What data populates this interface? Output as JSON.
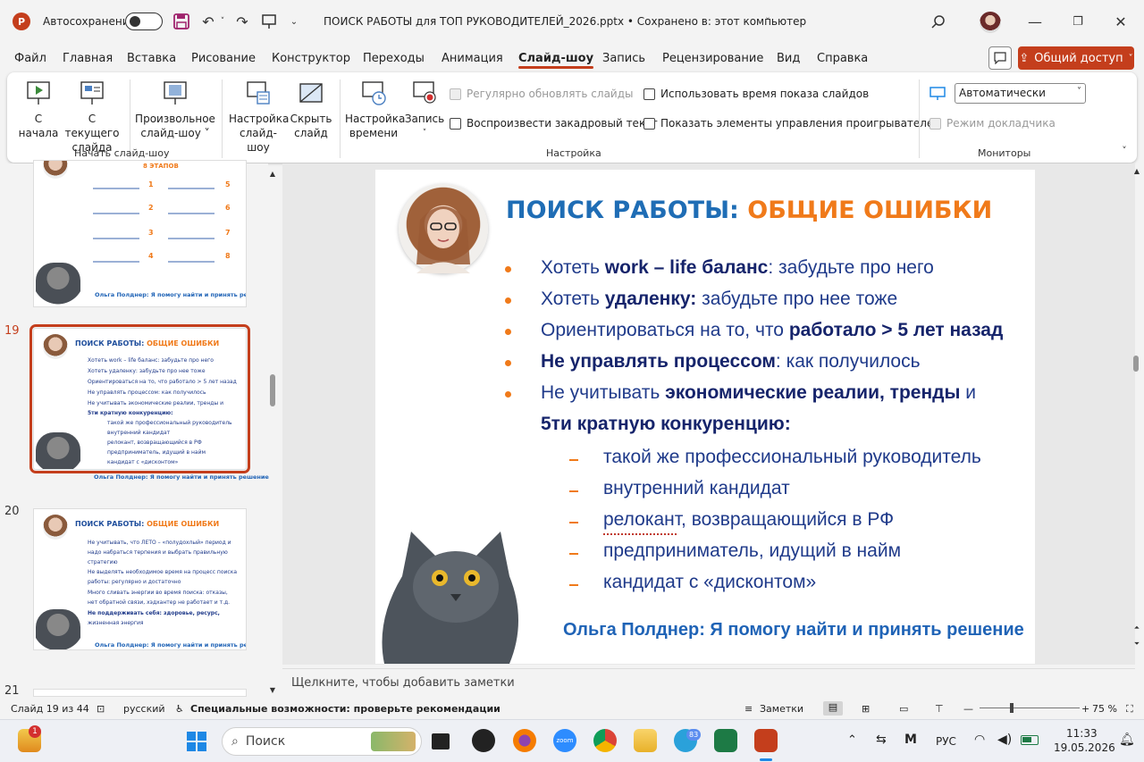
{
  "titlebar": {
    "autosave_label": "Автосохранение",
    "doc_title": "ПОИСК РАБОТЫ для ТОП РУКОВОДИТЕЛЕЙ_2026.pptx • Сохранено в: этот компьютер",
    "app_icon": "P"
  },
  "tabs": [
    "Файл",
    "Главная",
    "Вставка",
    "Рисование",
    "Конструктор",
    "Переходы",
    "Анимация",
    "Слайд-шоу",
    "Запись",
    "Рецензирование",
    "Вид",
    "Справка"
  ],
  "active_tab": "Слайд-шоу",
  "share_label": "Общий доступ",
  "ribbon": {
    "from_start": [
      "С",
      "начала"
    ],
    "from_current": [
      "С текущего",
      "слайда"
    ],
    "custom": [
      "Произвольное",
      "слайд-шоу ˅"
    ],
    "setup": [
      "Настройка",
      "слайд-шоу"
    ],
    "hide": [
      "Скрыть",
      "слайд"
    ],
    "timing": [
      "Настройка",
      "времени"
    ],
    "record": [
      "Запись",
      "˅"
    ],
    "group_start": "Начать слайд-шоу",
    "group_setup": "Настройка",
    "group_monitors": "Мониторы",
    "chk_refresh": "Регулярно обновлять слайды",
    "chk_narration": "Воспроизвести закадровый текст",
    "chk_timings": "Использовать время показа слайдов",
    "chk_controls": "Показать элементы управления проигрывателем",
    "chk_presenter": "Режим докладчика",
    "monitor_value": "Автоматически"
  },
  "thumbs": {
    "prev_title": "8 ЭТАПОВ",
    "prev_numbers": [
      "1",
      "5",
      "2",
      "6",
      "3",
      "7",
      "4",
      "8"
    ],
    "footer": "Ольга Полднер: Я помогу найти и принять решение",
    "n19": "19",
    "n20": "20",
    "n21": "21",
    "t19_title_a": "ПОИСК РАБОТЫ: ",
    "t19_title_b": "ОБЩИЕ ОШИБКИ",
    "t19_lines": [
      "Хотеть work – life баланс: забудьте про него",
      "Хотеть удаленку: забудьте про нее тоже",
      "Ориентироваться на то, что работало > 5 лет назад",
      "Не управлять процессом: как получилось",
      "Не учитывать экономические реалии, тренды и",
      "5ти кратную конкуренцию:",
      "такой же профессиональный руководитель",
      "внутренний кандидат",
      "релокант, возвращающийся в РФ",
      "предприниматель, идущий в найм",
      "кандидат с «дисконтом»"
    ],
    "t20_lines": [
      "Не учитывать, что ЛЕТО – «полудохлый» период и",
      "надо набраться терпения и выбрать правильную",
      "стратегию",
      "Не выделять необходимое время на процесс поиска",
      "работы: регулярно и достаточно",
      "Много сливать энергии во время поиска: отказы,",
      "нет обратной связи, хэдхантер не работает и т.д.",
      "Не поддерживать себя: здоровье, ресурс,",
      "жизненная энергия"
    ]
  },
  "slide": {
    "title_a": "ПОИСК РАБОТЫ: ",
    "title_b": "ОБЩИЕ ОШИБКИ",
    "b1_a": "Хотеть ",
    "b1_b": "work – life баланс",
    "b1_c": ": забудьте про него",
    "b2_a": "Хотеть ",
    "b2_b": "удаленку:",
    "b2_c": " забудьте про нее тоже",
    "b3_a": "Ориентироваться на то, что ",
    "b3_b": "работало > 5 лет назад",
    "b4_b": "Не управлять процессом",
    "b4_c": ": как получилось",
    "b5_a": "Не учитывать ",
    "b5_b": "экономические реалии, тренды",
    "b5_c": " и",
    "b6_b": "5ти кратную конкуренцию:",
    "sub": [
      "такой же профессиональный руководитель",
      "внутренний кандидат",
      "релокант, возвращающийся в РФ",
      "предприниматель, идущий в найм",
      "кандидат с «дисконтом»"
    ],
    "footer": "Ольга Полднер: Я помогу найти и принять решение"
  },
  "notes_placeholder": "Щелкните, чтобы добавить заметки",
  "status": {
    "slide": "Слайд 19 из 44",
    "lang": "русский",
    "access": "Специальные возможности: проверьте рекомендации",
    "notes": "Заметки",
    "zoom": "75 %"
  },
  "taskbar": {
    "search": "Поиск",
    "lang": "РУС",
    "time": "11:33",
    "date": "19.05.2026",
    "telegram_badge": "83",
    "weather_badge": "1"
  }
}
